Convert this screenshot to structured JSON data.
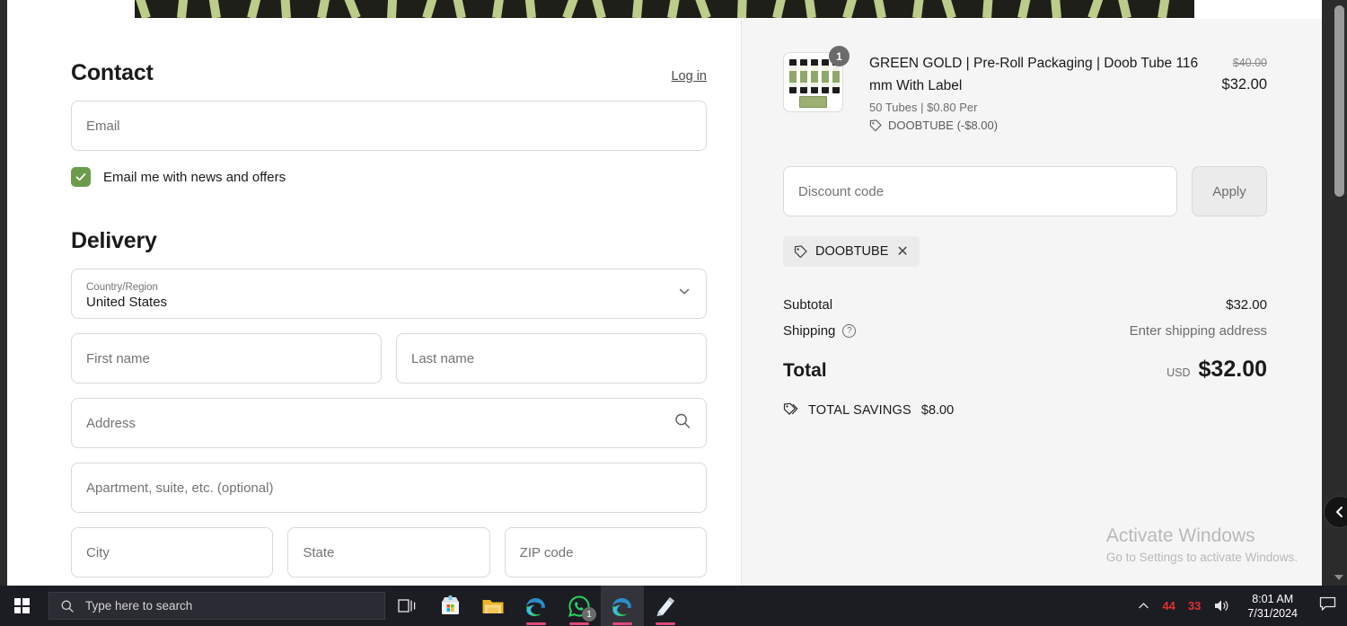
{
  "checkout": {
    "contact": {
      "title": "Contact",
      "login_label": "Log in",
      "email_placeholder": "Email",
      "newsletter_label": "Email me with news and offers",
      "newsletter_checked": true,
      "checkbox_color": "#6d9b4b"
    },
    "delivery": {
      "title": "Delivery",
      "country_label": "Country/Region",
      "country_value": "United States",
      "first_name_placeholder": "First name",
      "last_name_placeholder": "Last name",
      "address_placeholder": "Address",
      "apartment_placeholder": "Apartment, suite, etc. (optional)",
      "city_placeholder": "City",
      "state_placeholder": "State",
      "zip_placeholder": "ZIP code"
    }
  },
  "summary": {
    "line_item": {
      "title": "GREEN GOLD | Pre-Roll Packaging | Doob Tube 116 mm With Label",
      "variant": "50 Tubes | $0.80 Per",
      "discount_note": "DOOBTUBE (-$8.00)",
      "quantity": "1",
      "compare_price": "$40.00",
      "price": "$32.00"
    },
    "discount": {
      "placeholder": "Discount code",
      "apply_label": "Apply",
      "applied_code": "DOOBTUBE"
    },
    "totals": {
      "subtotal_label": "Subtotal",
      "subtotal_value": "$32.00",
      "shipping_label": "Shipping",
      "shipping_value": "Enter shipping address",
      "total_label": "Total",
      "total_currency": "USD",
      "total_value": "$32.00",
      "savings_label": "TOTAL SAVINGS",
      "savings_value": "$8.00"
    }
  },
  "watermark": {
    "title": "Activate Windows",
    "subtitle": "Go to Settings to activate Windows."
  },
  "taskbar": {
    "search_placeholder": "Type here to search",
    "apps": [
      {
        "name": "task-view",
        "icon": "task-view-icon",
        "active": false,
        "badge": null,
        "running": false
      },
      {
        "name": "microsoft-store",
        "icon": "store-icon",
        "active": false,
        "badge": null,
        "running": false
      },
      {
        "name": "file-explorer",
        "icon": "folder-icon",
        "active": false,
        "badge": null,
        "running": false
      },
      {
        "name": "microsoft-edge",
        "icon": "edge-icon",
        "active": false,
        "badge": null,
        "running": true
      },
      {
        "name": "whatsapp",
        "icon": "whatsapp-icon",
        "active": false,
        "badge": "1",
        "running": true
      },
      {
        "name": "microsoft-edge-2",
        "icon": "edge-icon",
        "active": true,
        "badge": null,
        "running": true
      },
      {
        "name": "notepad",
        "icon": "note-icon",
        "active": false,
        "badge": null,
        "running": true
      }
    ],
    "tray": {
      "overflow": "^",
      "red_badge_1": "44",
      "red_badge_2": "33",
      "time": "8:01 AM",
      "date": "7/31/2024"
    }
  }
}
